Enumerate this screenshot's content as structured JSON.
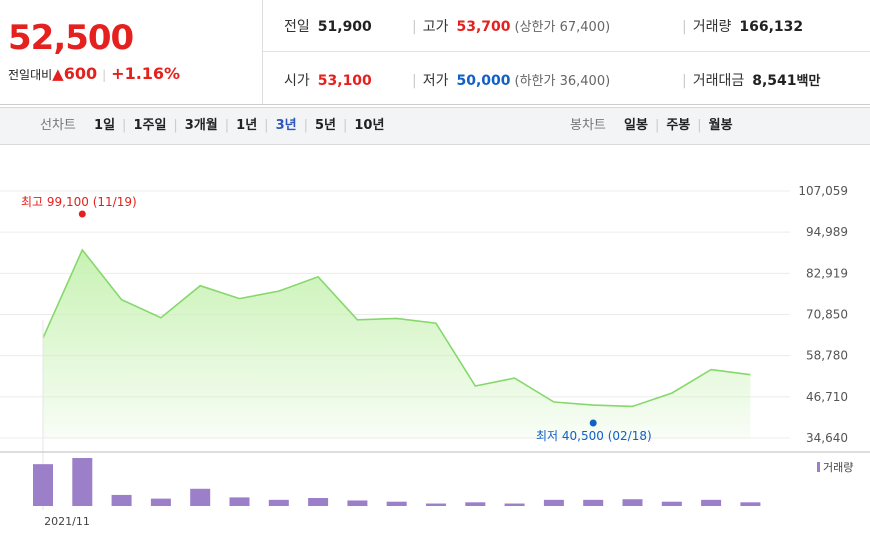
{
  "quote": {
    "price": "52,500",
    "change_label": "전일대비",
    "change_arrow": "▲",
    "change_amount": "600",
    "change_percent": "+1.16%",
    "prev_close_label": "전일",
    "prev_close": "51,900",
    "high_label": "고가",
    "high": "53,700",
    "upper_limit": "(상한가 67,400)",
    "volume_label": "거래량",
    "volume": "166,132",
    "open_label": "시가",
    "open": "53,100",
    "low_label": "저가",
    "low": "50,000",
    "lower_limit": "(하한가 36,400)",
    "amount_label": "거래대금",
    "amount": "8,541",
    "amount_unit": "백만"
  },
  "toolbar": {
    "line_label": "선차트",
    "periods": [
      "1일",
      "1주일",
      "3개월",
      "1년",
      "3년",
      "5년",
      "10년"
    ],
    "active_period": "3년",
    "candle_label": "봉차트",
    "candles": [
      "일봉",
      "주봉",
      "월봉"
    ]
  },
  "colors": {
    "up": "#e4211e",
    "down": "#1160c7",
    "line": "#86d86c",
    "fill": "#c8f2b4",
    "volume": "#9b80c9",
    "active": "#2e56b8"
  },
  "chart_data": {
    "type": "area",
    "x_label_text": "2021/11",
    "y_ticks": [
      107059,
      94989,
      82919,
      70850,
      58780,
      46710,
      34640
    ],
    "y_tick_labels": [
      "107,059",
      "94,989",
      "82,919",
      "70,850",
      "58,780",
      "46,710",
      "34,640"
    ],
    "ylim": [
      34640,
      107059
    ],
    "values": [
      64000,
      89800,
      75200,
      69900,
      79300,
      75500,
      77700,
      81900,
      69300,
      69700,
      68300,
      49900,
      52200,
      45200,
      44300,
      43900,
      47800,
      54700,
      53200
    ],
    "high_annotation": {
      "index": 1,
      "value": 99100,
      "text": "최고 99,100 (11/19)"
    },
    "low_annotation": {
      "index": 14,
      "value": 40500,
      "text": "최저 40,500 (02/18)"
    },
    "volume_label": "거래량",
    "volume": [
      340,
      390,
      90,
      60,
      140,
      70,
      50,
      65,
      45,
      35,
      20,
      30,
      20,
      50,
      50,
      55,
      35,
      50,
      30
    ]
  }
}
